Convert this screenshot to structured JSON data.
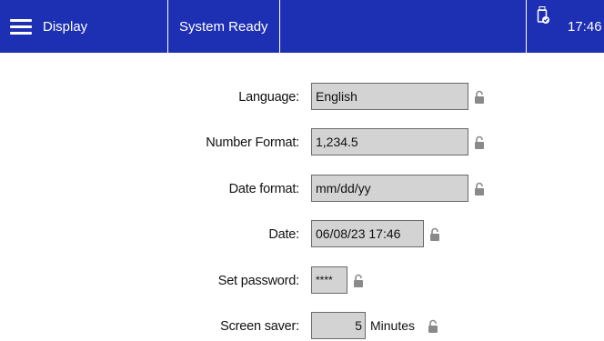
{
  "topbar": {
    "title": "Display",
    "status": "System Ready",
    "time": "17:46",
    "colors": {
      "background": "#1d2fb3",
      "text": "#ffffff"
    },
    "icons": {
      "menu": "hamburger-menu-icon",
      "usb": "usb-drive-check-icon"
    }
  },
  "settings": {
    "language": {
      "label": "Language:",
      "value": "English"
    },
    "number_format": {
      "label": "Number Format:",
      "value": "1,234.5"
    },
    "date_format": {
      "label": "Date format:",
      "value": "mm/dd/yy"
    },
    "date": {
      "label": "Date:",
      "value": "06/08/23 17:46"
    },
    "password": {
      "label": "Set password:",
      "value": "****"
    },
    "screen_saver": {
      "label": "Screen saver:",
      "value": "5",
      "unit": "Minutes"
    }
  },
  "colors": {
    "field_bg": "#d3d3d3",
    "lock": "#8a8a8a"
  },
  "icons": {
    "lock": "unlocked-padlock-icon"
  }
}
